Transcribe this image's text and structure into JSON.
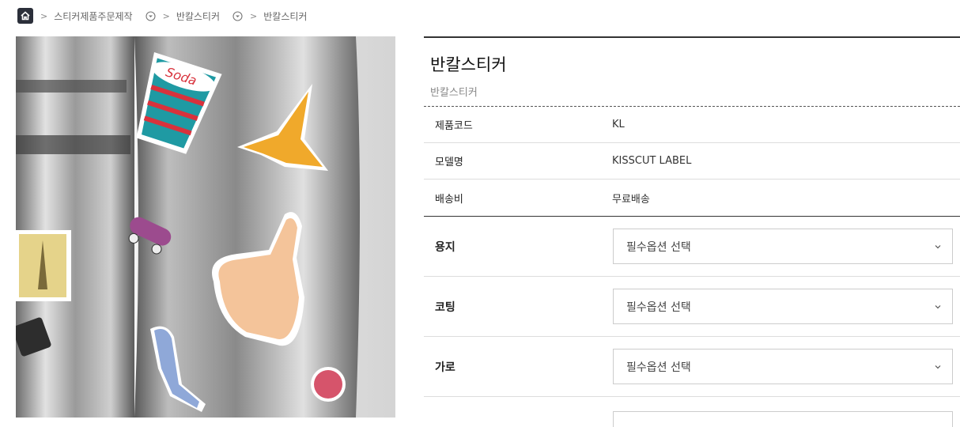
{
  "breadcrumb": {
    "items": [
      "스티커제품주문제작",
      "반칼스티커",
      "반칼스티커"
    ],
    "home_icon": "home-icon",
    "dropdown_icon": "chevron-circle-down-icon"
  },
  "product": {
    "title": "반칼스티커",
    "subtitle": "반칼스티커",
    "image_text": "Soda"
  },
  "info": [
    {
      "label": "제품코드",
      "value": "KL"
    },
    {
      "label": "모델명",
      "value": "KISSCUT LABEL"
    },
    {
      "label": "배송비",
      "value": "무료배송"
    }
  ],
  "options": [
    {
      "label": "용지",
      "placeholder": "필수옵션 선택"
    },
    {
      "label": "코팅",
      "placeholder": "필수옵션 선택"
    },
    {
      "label": "가로",
      "placeholder": "필수옵션 선택"
    }
  ]
}
